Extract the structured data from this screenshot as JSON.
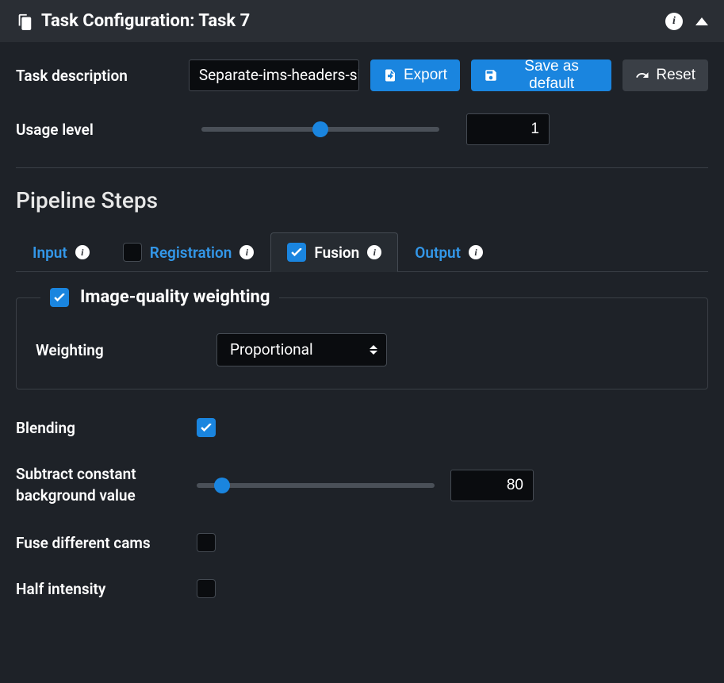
{
  "header": {
    "title": "Task Configuration: Task 7"
  },
  "toolbar": {
    "description_label": "Task description",
    "description_value": "Separate-ims-headers-single-channel",
    "export_label": "Export",
    "save_label": "Save as default",
    "reset_label": "Reset",
    "usage_label": "Usage level",
    "usage_value": "1"
  },
  "pipeline": {
    "title": "Pipeline Steps",
    "tabs": [
      {
        "label": "Input",
        "checked": null
      },
      {
        "label": "Registration",
        "checked": false
      },
      {
        "label": "Fusion",
        "checked": true
      },
      {
        "label": "Output",
        "checked": null
      }
    ]
  },
  "fusion": {
    "iqw": {
      "legend": "Image-quality weighting",
      "checked": true,
      "weighting_label": "Weighting",
      "weighting_value": "Proportional"
    },
    "blending": {
      "label": "Blending",
      "checked": true
    },
    "subtract_bg": {
      "label": "Subtract constant background value",
      "value": "80"
    },
    "fuse_cams": {
      "label": "Fuse different cams",
      "checked": false
    },
    "half_intensity": {
      "label": "Half intensity",
      "checked": false
    }
  }
}
